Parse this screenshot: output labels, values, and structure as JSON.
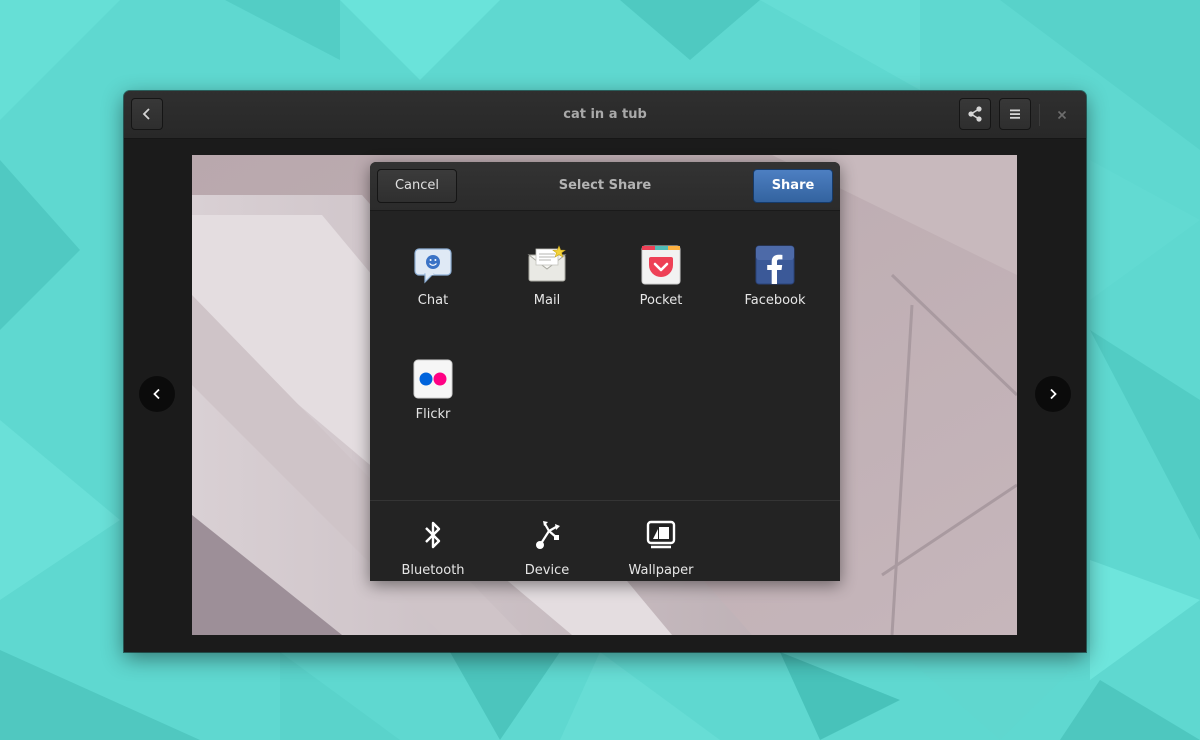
{
  "window": {
    "title": "cat in a tub"
  },
  "share_dialog": {
    "title": "Select Share",
    "cancel_label": "Cancel",
    "share_label": "Share",
    "accounts": [
      {
        "label": "Chat",
        "icon": "chat-icon"
      },
      {
        "label": "Mail",
        "icon": "mail-icon"
      },
      {
        "label": "Pocket",
        "icon": "pocket-icon"
      },
      {
        "label": "Facebook",
        "icon": "facebook-icon"
      },
      {
        "label": "Flickr",
        "icon": "flickr-icon"
      }
    ],
    "devices": [
      {
        "label": "Bluetooth",
        "icon": "bluetooth-icon"
      },
      {
        "label": "Device",
        "icon": "device-icon"
      },
      {
        "label": "Wallpaper",
        "icon": "wallpaper-icon"
      }
    ]
  },
  "colors": {
    "desktop": "#5cd6cf",
    "share_button": "#3d6fb0",
    "facebook": "#3b5998",
    "pocket": "#ee4056",
    "flickr_blue": "#0063dc",
    "flickr_pink": "#ff0084"
  }
}
